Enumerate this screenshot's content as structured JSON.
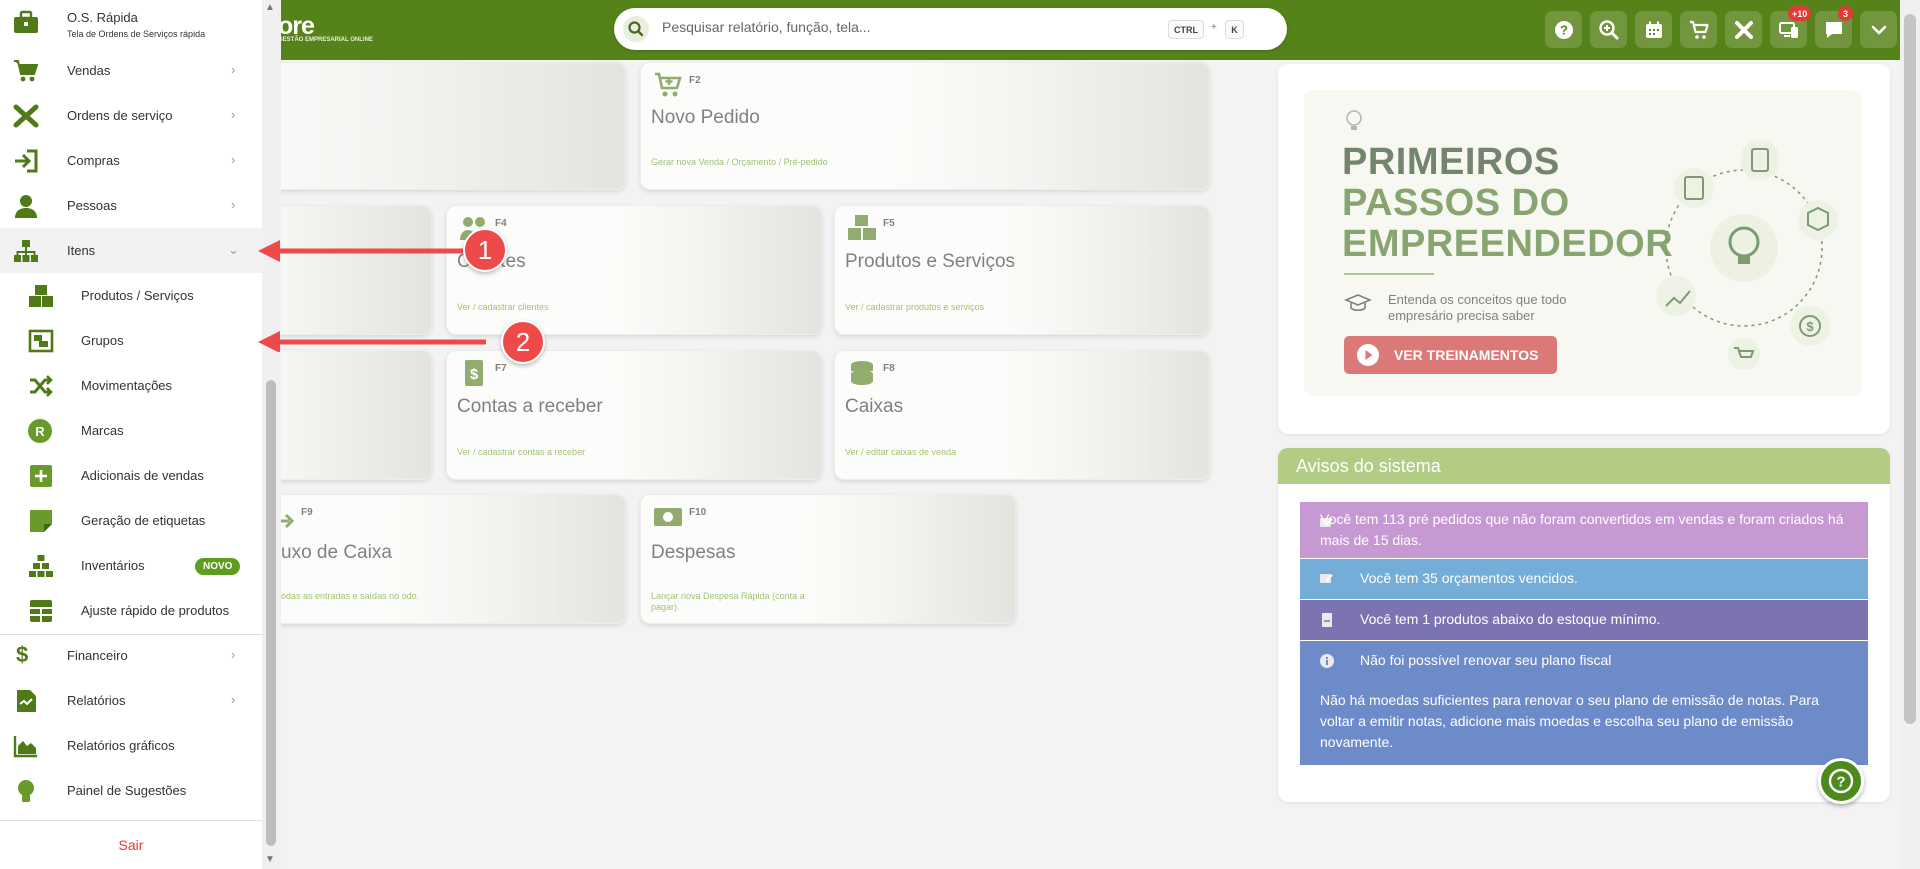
{
  "app": {
    "logo_text": "ore",
    "logo_subtext": "GESTÃO EMPRESARIAL ONLINE"
  },
  "search": {
    "placeholder": "Pesquisar relatório, função, tela...",
    "shortcut_ctrl": "CTRL",
    "shortcut_plus": "+",
    "shortcut_key": "K"
  },
  "toolbar": {
    "badge_devices": "+10",
    "badge_messages": "3"
  },
  "tiles": [
    {
      "key": "F2",
      "title": "Novo Pedido",
      "desc": "Gerar nova Venda / Orçamento / Pré-pedido"
    },
    {
      "key": "F4",
      "title": "Clientes",
      "desc": "Ver / cadastrar clientes"
    },
    {
      "key": "F5",
      "title": "Produtos e Serviços",
      "desc": "Ver / cadastrar produtos e serviços"
    },
    {
      "key": "F7",
      "title": "Contas a receber",
      "desc": "Ver / cadastrar contas a receber"
    },
    {
      "key": "F8",
      "title": "Caixas",
      "desc": "Ver / editar caixas de venda"
    },
    {
      "key": "F9",
      "title": "uxo de Caixa",
      "desc": "odas as entradas e saídas no odo."
    },
    {
      "key": "F10",
      "title": "Despesas",
      "desc": "Lançar nova Despesa Rápida (conta a pagar)."
    }
  ],
  "banner": {
    "line1": "PRIMEIROS",
    "line2": "PASSOS DO",
    "line3": "EMPREENDEDOR",
    "subtitle": "Entenda os conceitos que todo empresário precisa saber",
    "button": "VER TREINAMENTOS"
  },
  "avisos": {
    "title": "Avisos do sistema",
    "items": [
      {
        "text": "Você tem 113 pré pedidos que não foram convertidos em vendas e foram criados há mais de 15 dias.",
        "color": "#a45bb7"
      },
      {
        "text": "Você tem 35 orçamentos vencidos.",
        "color": "#1f7cc0"
      },
      {
        "text": "Você tem 1 produtos abaixo do estoque mínimo.",
        "color": "#2b2080"
      },
      {
        "text": "Não foi possível renovar seu plano fiscal",
        "detail": "Não há moedas suficientes para renovar o seu plano de emissão de notas. Para voltar a emitir notas, adicione mais moedas e escolha seu plano de emissão novamente.",
        "color": "#1544a8"
      }
    ]
  },
  "sidebar": {
    "os_rapida": {
      "label": "O.S. Rápida",
      "sublabel": "Tela de Ordens de Serviços rápida"
    },
    "items": [
      {
        "label": "Vendas"
      },
      {
        "label": "Ordens de serviço"
      },
      {
        "label": "Compras"
      },
      {
        "label": "Pessoas"
      },
      {
        "label": "Itens"
      },
      {
        "label": "Financeiro"
      },
      {
        "label": "Relatórios"
      },
      {
        "label": "Relatórios gráficos"
      },
      {
        "label": "Painel de Sugestões"
      }
    ],
    "sub_items": [
      {
        "label": "Produtos / Serviços"
      },
      {
        "label": "Grupos"
      },
      {
        "label": "Movimentações"
      },
      {
        "label": "Marcas",
        "icon_letter": "R"
      },
      {
        "label": "Adicionais de vendas"
      },
      {
        "label": "Geração de etiquetas"
      },
      {
        "label": "Inventários",
        "badge": "NOVO"
      },
      {
        "label": "Ajuste rápido de produtos"
      }
    ],
    "logout": "Sair"
  },
  "annotations": {
    "callout1": "1",
    "callout2": "2"
  },
  "colors": {
    "brand_green": "#56821a",
    "accent_red": "#ef4a4a"
  }
}
